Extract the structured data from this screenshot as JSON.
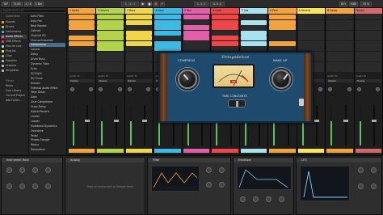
{
  "transport": {
    "tempo": "75.00",
    "meter": "4 / 4",
    "position": "1 . 1 . 1",
    "quantize": "1 Bar",
    "cpu": "55 %",
    "key_label": "KEY",
    "midi_label": "MIDI"
  },
  "browser": {
    "search_placeholder": "Search (Ctrl + F)",
    "collections_label": "Collections",
    "categories": [
      "Sounds",
      "Drums",
      "Instruments",
      "Audio Effects",
      "MIDI Effects",
      "Max for Live",
      "Plug-Ins",
      "Clips",
      "Samples",
      "Grooves",
      "Templates"
    ],
    "places": [
      "Places",
      "Packs",
      "User Library",
      "Current Project",
      "Add Folder..."
    ],
    "items": [
      "Auto Filter",
      "Auto Pan",
      "Beat Repeat",
      "Cabinet",
      "Channel EQ",
      "Chorus-Ensemble",
      "Compressor",
      "Corpus",
      "Delay",
      "Drum Buss",
      "Dynamic Tube",
      "Echo",
      "EQ Eight",
      "EQ Three",
      "Erosion",
      "External Audio Effect",
      "Filter Delay",
      "Gate",
      "Glue Compressor",
      "Grain Delay",
      "Hybrid Reverb",
      "Limiter",
      "Looper",
      "Multiband Dynamics",
      "Overdrive",
      "Pedal",
      "Phaser-Flanger",
      "Redux",
      "Resonators",
      "Reverb",
      "Saturator",
      "Shifter",
      "Spectral Resonator",
      "Spectral Time",
      "Spectrum",
      "Tuner",
      "Utility",
      "Vinyl Distortion",
      "Vocoder"
    ]
  },
  "tracks": [
    {
      "name": "1 Audio",
      "color": "#f2a33c"
    },
    {
      "name": "2 Drums",
      "color": "#b2d34a"
    },
    {
      "name": "3 Bass",
      "color": "#f2d64a"
    },
    {
      "name": "4 Keys",
      "color": "#3db9e6"
    },
    {
      "name": "5 Pad",
      "color": "#e05fa8"
    },
    {
      "name": "6 Lead",
      "color": "#ef4747"
    },
    {
      "name": "7 Vox",
      "color": "#a6e3ee"
    },
    {
      "name": "8 Perc",
      "color": "#f2a33c"
    },
    {
      "name": "A Reverb",
      "color": "#f9e55d"
    },
    {
      "name": "B Delay",
      "color": "#f2a33c"
    },
    {
      "name": "Master",
      "color": "#d26a6a"
    }
  ],
  "mixer": {
    "audio_to_label": "Audio To",
    "master_label": "Master",
    "monitor_labels": [
      "In",
      "Auto",
      "Off"
    ]
  },
  "plugin": {
    "brand": "Vintagedeluxe",
    "left_label": "COMPRESS",
    "right_label": "MAKE UP",
    "center_label": "TIME CONSTANTS",
    "meter_db": "dB",
    "scale_marks": [
      "-20",
      "-10",
      "-7",
      "-5",
      "-3",
      "-2",
      "-1",
      "0"
    ]
  },
  "devices": {
    "instrument_rack": "Instrument Rack",
    "analog": "Analog",
    "filter": "Filter",
    "envelope": "Envelope",
    "drop_hint": "Drop an instrument or Sample Here",
    "lfo": "LFO",
    "osc1": "Osc 1",
    "osc2": "Osc 2",
    "mix_label": "Mix",
    "knob_labels": [
      "Offset",
      "Freq",
      "Res",
      "Attack",
      "Decay",
      "Sustain",
      "Release",
      "Amount"
    ],
    "values": [
      "0.00 Hz",
      "12.0 st",
      "1.00 kHz",
      "0.00 dB",
      "65 %",
      "1.00 ms"
    ]
  },
  "status": {
    "track": "1-Instrument Rack"
  }
}
